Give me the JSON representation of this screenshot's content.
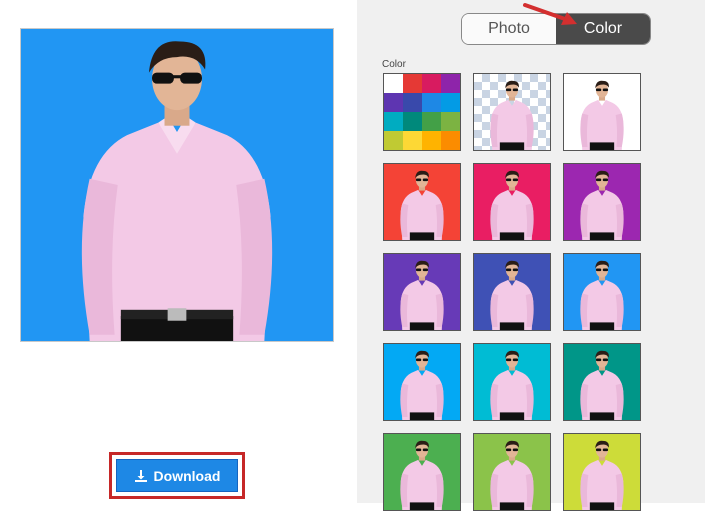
{
  "toggle": {
    "photo_label": "Photo",
    "color_label": "Color",
    "active": "Color"
  },
  "section": {
    "label": "Color"
  },
  "download": {
    "label": "Download",
    "icon": "download-icon"
  },
  "preview": {
    "background": "#2196f3",
    "subject": "man in pink shirt with sunglasses"
  },
  "palette": [
    "#ffffff",
    "#e53935",
    "#d81b60",
    "#8e24aa",
    "#5e35b1",
    "#3949ab",
    "#1e88e5",
    "#039be5",
    "#00acc1",
    "#00897b",
    "#43a047",
    "#7cb342",
    "#c0ca33",
    "#fdd835",
    "#ffb300",
    "#fb8c00"
  ],
  "swatches": [
    "transparent",
    "#ffffff",
    "#f44336",
    "#e91e63",
    "#9c27b0",
    "#673ab7",
    "#3f51b5",
    "#2196f3",
    "#03a9f4",
    "#00bcd4",
    "#009688",
    "#4caf50",
    "#8bc34a",
    "#cddc39"
  ],
  "colors": {
    "accent": "#1e88e5",
    "highlight": "#c62828",
    "toggle_active": "#4a4a4a"
  }
}
